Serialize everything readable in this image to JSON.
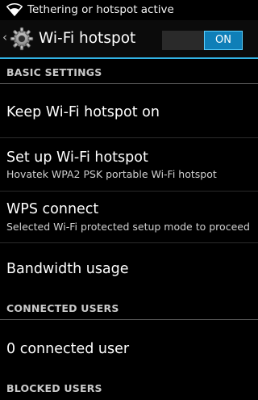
{
  "status_bar": {
    "notification": "Tethering or hotspot active",
    "icon": "wifi-hotspot-icon"
  },
  "action_bar": {
    "up_glyph": "‹",
    "icon": "settings-gear-icon",
    "title": "Wi-Fi hotspot",
    "toggle": {
      "label": "ON",
      "state": "on",
      "color": "#0f7fb8"
    }
  },
  "basic_settings": {
    "header": "BASIC SETTINGS",
    "items": [
      {
        "title": "Keep Wi-Fi hotspot on",
        "summary": ""
      },
      {
        "title": "Set up Wi-Fi hotspot",
        "summary": "Hovatek  WPA2 PSK portable Wi-Fi hotspot"
      },
      {
        "title": "WPS connect",
        "summary": "Selected Wi-Fi protected setup mode to proceed"
      },
      {
        "title": "Bandwidth usage",
        "summary": ""
      }
    ]
  },
  "connected_users": {
    "header": "CONNECTED USERS",
    "items": [
      {
        "title": "0 connected user"
      }
    ]
  },
  "blocked_users": {
    "header": "BLOCKED USERS"
  },
  "theme": {
    "accent": "#32b4e6",
    "background": "#000000"
  }
}
